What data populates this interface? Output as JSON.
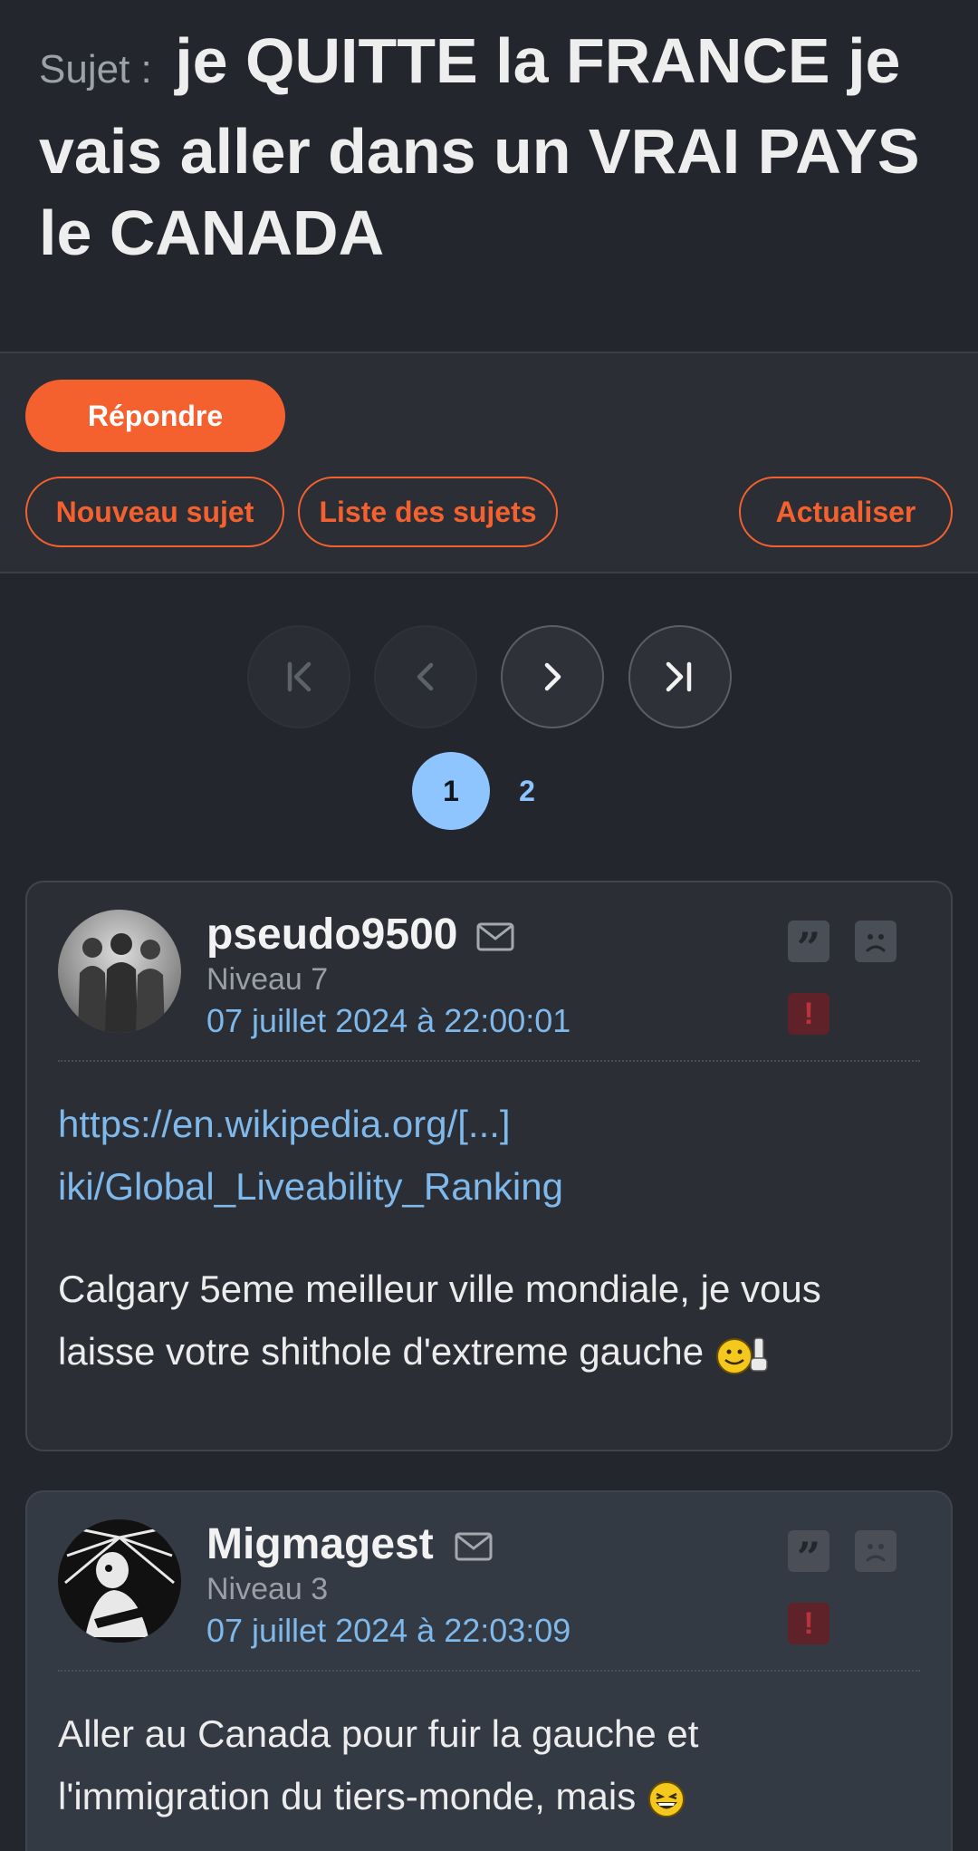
{
  "topic": {
    "label": "Sujet :",
    "title": "je QUITTE la FRANCE je vais aller dans un VRAI PAYS le CANADA"
  },
  "actions": {
    "reply": "Répondre",
    "new_topic": "Nouveau sujet",
    "topic_list": "Liste des sujets",
    "refresh": "Actualiser"
  },
  "pagination": {
    "current": "1",
    "pages": [
      "1",
      "2"
    ]
  },
  "posts": [
    {
      "username": "pseudo9500",
      "level": "Niveau 7",
      "date": "07 juillet 2024 à 22:00:01",
      "link_line1": "https://en.wikipedia.org/[...]",
      "link_line2": "iki/Global_Liveability_Ranking",
      "text": "Calgary 5eme meilleur ville mondiale, je vous laisse votre shithole d'extreme gauche"
    },
    {
      "username": "Migmagest",
      "level": "Niveau 3",
      "date": "07 juillet 2024 à 22:03:09",
      "text": "Aller au Canada pour fuir la gauche et l'immigration du tiers-monde, mais"
    }
  ],
  "colors": {
    "background": "#23262c",
    "accent": "#f4612e",
    "link": "#7fb8ea",
    "page_active": "#8ec5ff"
  }
}
